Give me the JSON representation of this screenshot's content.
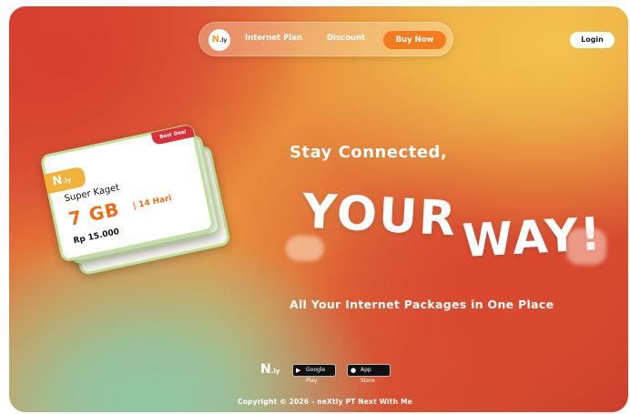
{
  "nav": {
    "logo": "N",
    "logo_suffix": ".ly",
    "links": [
      "Internet Plan",
      "Discount"
    ],
    "cta": "Buy Now",
    "login": "Login"
  },
  "card": {
    "logo": "N",
    "logo_suffix": ".ly",
    "badge": "Best Deal",
    "plan_name": "Super Kaget",
    "data": "7 GB",
    "duration": "| 14 Hari",
    "price": "Rp 15.000"
  },
  "hero": {
    "tagline": "Stay Connected,",
    "line1": "YOUR",
    "line2": "WAY!",
    "subtitle": "All Your Internet Packages in One Place"
  },
  "footer": {
    "logo": "N",
    "logo_suffix": ".ly",
    "google_play": "Google Play",
    "app_store": "App Store",
    "copyright": "Copyright © 2026 - neXtly PT Next With Me"
  },
  "colors": {
    "accent": "#f47a1f",
    "card_border": "#bfe29a",
    "badge": "#d9313a"
  }
}
